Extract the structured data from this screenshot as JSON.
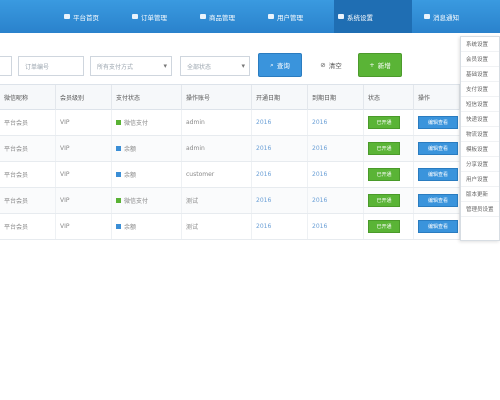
{
  "nav": {
    "items": [
      {
        "label": "平台首页",
        "icon": "home-icon",
        "active": false
      },
      {
        "label": "订单管理",
        "icon": "order-icon",
        "active": false
      },
      {
        "label": "商品管理",
        "icon": "goods-icon",
        "active": false
      },
      {
        "label": "用户管理",
        "icon": "users-icon",
        "active": false
      },
      {
        "label": "系统设置",
        "icon": "settings-icon",
        "active": true
      },
      {
        "label": "消息通知",
        "icon": "message-icon",
        "active": false
      }
    ]
  },
  "filters": {
    "input1_placeholder": "",
    "input2_placeholder": "订单编号",
    "select1_value": "所有支付方式",
    "select2_value": "全部状态",
    "search_label": "查询",
    "clear_label": "清空",
    "add_label": "新增"
  },
  "table": {
    "headers": [
      "微信昵称",
      "会员级别",
      "支付状态",
      "操作账号",
      "开通日期",
      "到期日期",
      "状态",
      "操作"
    ],
    "rows": [
      {
        "c1": "平台会员",
        "c2": "VIP",
        "status": "微信支付",
        "status_color": "green",
        "c4": "admin",
        "c5": "2016",
        "c6": "2016",
        "btn1": "已开通",
        "btn2": "编辑查看"
      },
      {
        "c1": "平台会员",
        "c2": "VIP",
        "status": "余额",
        "status_color": "blue",
        "c4": "admin",
        "c5": "2016",
        "c6": "2016",
        "btn1": "已开通",
        "btn2": "编辑查看"
      },
      {
        "c1": "平台会员",
        "c2": "VIP",
        "status": "余额",
        "status_color": "blue",
        "c4": "customer",
        "c5": "2016",
        "c6": "2016",
        "btn1": "已开通",
        "btn2": "编辑查看"
      },
      {
        "c1": "平台会员",
        "c2": "VIP",
        "status": "微信支付",
        "status_color": "green",
        "c4": "测试",
        "c5": "2016",
        "c6": "2016",
        "btn1": "已开通",
        "btn2": "编辑查看"
      },
      {
        "c1": "平台会员",
        "c2": "VIP",
        "status": "余额",
        "status_color": "blue",
        "c4": "测试",
        "c5": "2016",
        "c6": "2016",
        "btn1": "已开通",
        "btn2": "编辑查看"
      }
    ]
  },
  "dropdown": {
    "items": [
      "系统设置",
      "会员设置",
      "基础设置",
      "支付设置",
      "短信设置",
      "快递设置",
      "物流设置",
      "模板设置",
      "分享设置",
      "用户设置",
      "版本更新",
      "管理员设置"
    ]
  }
}
